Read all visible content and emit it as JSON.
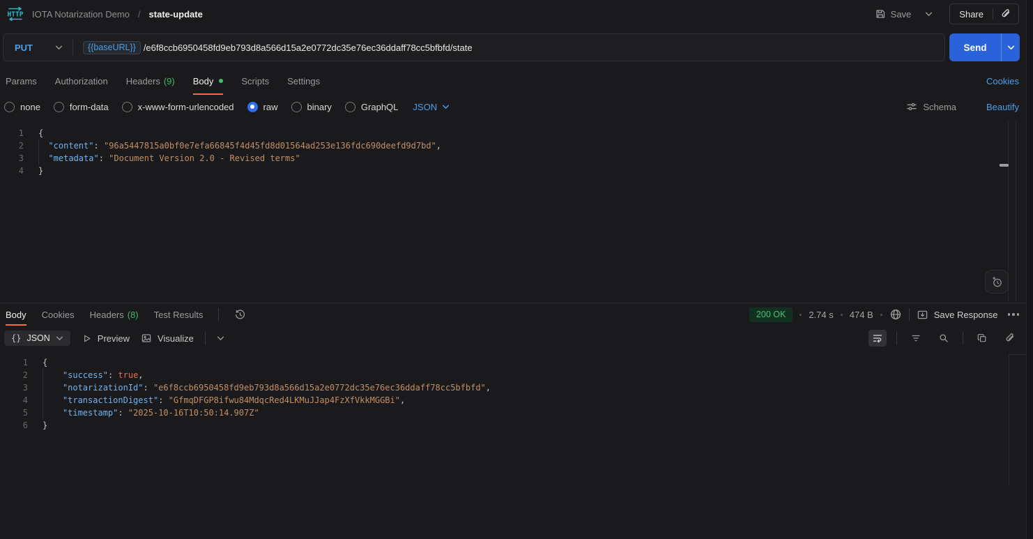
{
  "header": {
    "request_type_badge": "HTTP",
    "collection_name": "IOTA Notarization Demo",
    "breadcrumb_separator": "/",
    "request_name": "state-update",
    "save_label": "Save",
    "share_label": "Share"
  },
  "request": {
    "method": "PUT",
    "url_variable": "{{baseURL}}",
    "url_path": "/e6f8ccb6950458fd9eb793d8a566d15a2e0772dc35e76ec36ddaff78cc5bfbfd/state",
    "send_label": "Send",
    "tabs": [
      {
        "label": "Params"
      },
      {
        "label": "Authorization"
      },
      {
        "label": "Headers",
        "count": "(9)"
      },
      {
        "label": "Body",
        "active": true,
        "has_dot": true
      },
      {
        "label": "Scripts"
      },
      {
        "label": "Settings"
      }
    ],
    "cookies_link": "Cookies",
    "body_modes": [
      "none",
      "form-data",
      "x-www-form-urlencoded",
      "raw",
      "binary",
      "GraphQL"
    ],
    "selected_mode": "raw",
    "raw_language": "JSON",
    "schema_label": "Schema",
    "beautify_label": "Beautify",
    "editor_lines": [
      [
        {
          "t": "punct",
          "v": "{"
        }
      ],
      [
        {
          "t": "guide",
          "v": ""
        },
        {
          "t": "plain",
          "v": "  "
        },
        {
          "t": "key",
          "v": "\"content\""
        },
        {
          "t": "punct",
          "v": ": "
        },
        {
          "t": "str",
          "v": "\"96a5447815a0bf0e7efa66845f4d45fd8d01564ad253e136fdc690deefd9d7bd\""
        },
        {
          "t": "punct",
          "v": ","
        }
      ],
      [
        {
          "t": "guide",
          "v": ""
        },
        {
          "t": "plain",
          "v": "  "
        },
        {
          "t": "key",
          "v": "\"metadata\""
        },
        {
          "t": "punct",
          "v": ": "
        },
        {
          "t": "str",
          "v": "\"Document Version 2.0 - Revised terms\""
        }
      ],
      [
        {
          "t": "punct",
          "v": "}"
        }
      ]
    ]
  },
  "response": {
    "tabs": [
      {
        "label": "Body",
        "active": true
      },
      {
        "label": "Cookies"
      },
      {
        "label": "Headers",
        "count": "(8)"
      },
      {
        "label": "Test Results"
      }
    ],
    "status": "200 OK",
    "time": "2.74 s",
    "size": "474 B",
    "save_response_label": "Save Response",
    "format_label": "JSON",
    "format_braces": "{}",
    "preview_label": "Preview",
    "visualize_label": "Visualize",
    "editor_lines": [
      [
        {
          "t": "punct",
          "v": "{"
        }
      ],
      [
        {
          "t": "guide",
          "v": ""
        },
        {
          "t": "plain",
          "v": "    "
        },
        {
          "t": "key",
          "v": "\"success\""
        },
        {
          "t": "punct",
          "v": ": "
        },
        {
          "t": "bool",
          "v": "true"
        },
        {
          "t": "punct",
          "v": ","
        }
      ],
      [
        {
          "t": "guide",
          "v": ""
        },
        {
          "t": "plain",
          "v": "    "
        },
        {
          "t": "key",
          "v": "\"notarizationId\""
        },
        {
          "t": "punct",
          "v": ": "
        },
        {
          "t": "str",
          "v": "\"e6f8ccb6950458fd9eb793d8a566d15a2e0772dc35e76ec36ddaff78cc5bfbfd\""
        },
        {
          "t": "punct",
          "v": ","
        }
      ],
      [
        {
          "t": "guide",
          "v": ""
        },
        {
          "t": "plain",
          "v": "    "
        },
        {
          "t": "key",
          "v": "\"transactionDigest\""
        },
        {
          "t": "punct",
          "v": ": "
        },
        {
          "t": "str",
          "v": "\"GfmqDFGP8ifwu84MdqcRed4LKMuJJap4FzXfVkkMGGBi\""
        },
        {
          "t": "punct",
          "v": ","
        }
      ],
      [
        {
          "t": "guide",
          "v": ""
        },
        {
          "t": "plain",
          "v": "    "
        },
        {
          "t": "key",
          "v": "\"timestamp\""
        },
        {
          "t": "punct",
          "v": ": "
        },
        {
          "t": "str",
          "v": "\"2025-10-16T10:50:14.907Z\""
        }
      ],
      [
        {
          "t": "punct",
          "v": "}"
        }
      ]
    ]
  },
  "icons": {
    "http-brand-icon": "HTTP text with cyan request/response arrows",
    "save-icon": "floppy-disk",
    "chevron-down-icon": "v chevron",
    "link-icon": "paperclip",
    "sliders-icon": "schema sliders",
    "clock-history-icon": "clock with history arrow",
    "globe-icon": "network globe",
    "save-response-icon": "box with down arrow",
    "more-options-icon": "three dots",
    "wrap-text-icon": "text wrap return arrow",
    "filter-icon": "funnel lines",
    "search-icon": "magnifier",
    "copy-icon": "two squares",
    "play-icon": "triangle",
    "image-icon": "picture frame",
    "sparkle-icon": "postbot sparkle circle"
  },
  "colors": {
    "accent_orange": "#ff6c37",
    "link_blue": "#4a9eea",
    "send_blue": "#2a63d9",
    "count_green": "#45b36b",
    "status_green": "#4bc17e",
    "status_badge_bg": "#10311f",
    "brand_cyan": "#2fb6c9",
    "code_key": "#6fb3ef",
    "code_string": "#c28f63",
    "code_boolean": "#e06c4f"
  }
}
